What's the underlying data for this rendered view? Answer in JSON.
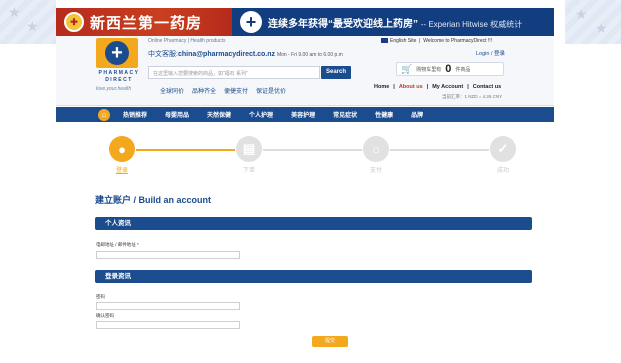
{
  "colors": {
    "brand_blue": "#1b4c8d",
    "accent_orange": "#f3a81e",
    "banner_red": "#b52a1c"
  },
  "banner": {
    "cn_title": "新西兰第一药房",
    "headline": "连续多年获得“最受欢迎线上药房”",
    "source": "-- Experian Hitwise 权威统计"
  },
  "header": {
    "logo_text": "PHARMACY DIRECT",
    "logo_tagline": "love.your.health",
    "small_label": "Online Pharmacy | Health products",
    "contact_prefix": "中文客服:",
    "contact_email": "china@pharmacydirect.co.nz",
    "contact_hours": "Mon - Fri 9.00 am to 6.00 p.m",
    "search_placeholder": "在这里输入您要搜索的商品，如“福石 系列”",
    "search_button": "Search",
    "quick_links": [
      "全球同价",
      "品种齐全",
      "便捷支付",
      "保证是优价"
    ],
    "english_site": "English Site",
    "welcome": "Welcome to PharmacyDirect !!!",
    "login": "Login / 登录",
    "cart_label": "购物车里有",
    "cart_count": "0",
    "cart_unit": "件商品",
    "top_nav": [
      "Home",
      "About us",
      "My Account",
      "Contact us"
    ],
    "rate": "当前汇率：1 NZD = 4.26 CNY"
  },
  "navbar": {
    "items": [
      "热销推荐",
      "母婴用品",
      "天然保健",
      "个人护理",
      "美容护理",
      "常见症状",
      "性健康",
      "品牌"
    ]
  },
  "steps": [
    {
      "label": "登录",
      "icon": "user-icon",
      "active": true
    },
    {
      "label": "下单",
      "icon": "document-icon",
      "active": false
    },
    {
      "label": "支付",
      "icon": "search-icon",
      "active": false
    },
    {
      "label": "成功",
      "icon": "check-icon",
      "active": false
    }
  ],
  "form": {
    "title": "建立账户 / Build an account",
    "section_personal": "个人资讯",
    "email_label": "电邮地址 / 邮件地址 *",
    "section_login": "登录资讯",
    "password_label": "密码",
    "confirm_password_label": "确认密码",
    "submit": "提交"
  }
}
